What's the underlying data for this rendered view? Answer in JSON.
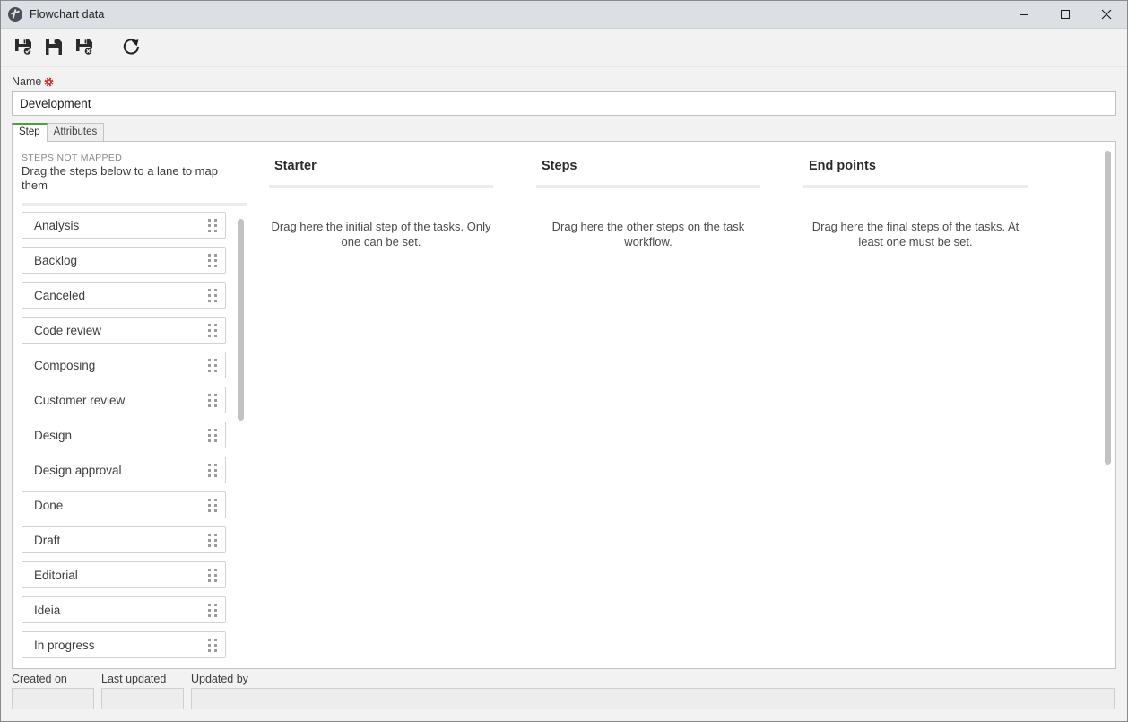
{
  "window": {
    "title": "Flowchart data",
    "icon": "globe-icon",
    "controls": {
      "minimize": "minimize-icon",
      "maximize": "maximize-icon",
      "close": "close-icon"
    }
  },
  "toolbar": {
    "buttons": [
      {
        "name": "save-new-button",
        "icon": "floppy-disk-new-icon"
      },
      {
        "name": "save-button",
        "icon": "floppy-disk-icon"
      },
      {
        "name": "save-and-close-button",
        "icon": "floppy-disk-close-icon"
      },
      {
        "name": "refresh-button",
        "icon": "refresh-icon"
      }
    ]
  },
  "form": {
    "name_label": "Name",
    "name_required_icon": "required-asterisk-icon",
    "name_value": "Development",
    "name_placeholder": ""
  },
  "tabs": [
    {
      "label": "Step",
      "active": true
    },
    {
      "label": "Attributes",
      "active": false
    }
  ],
  "unmapped": {
    "heading": "STEPS NOT MAPPED",
    "subtitle": "Drag the steps below to a lane to map them",
    "steps": [
      "Analysis",
      "Backlog",
      "Canceled",
      "Code review",
      "Composing",
      "Customer review",
      "Design",
      "Design approval",
      "Done",
      "Draft",
      "Editorial",
      "Ideia",
      "In progress"
    ]
  },
  "lanes": [
    {
      "title": "Starter",
      "hint": "Drag here the initial step of the tasks. Only one can be set."
    },
    {
      "title": "Steps",
      "hint": "Drag here the other steps on the task workflow."
    },
    {
      "title": "End points",
      "hint": "Drag here the final steps of the tasks. At least one must be set."
    }
  ],
  "footer": {
    "created_on_label": "Created on",
    "created_on_value": "",
    "last_updated_label": "Last updated",
    "last_updated_value": "",
    "updated_by_label": "Updated by",
    "updated_by_value": ""
  },
  "colors": {
    "accent_tab": "#4f9e41",
    "required": "#d32f2f",
    "titlebar": "#dcdfe4",
    "scrollbar_thumb": "#c2c2c2"
  }
}
